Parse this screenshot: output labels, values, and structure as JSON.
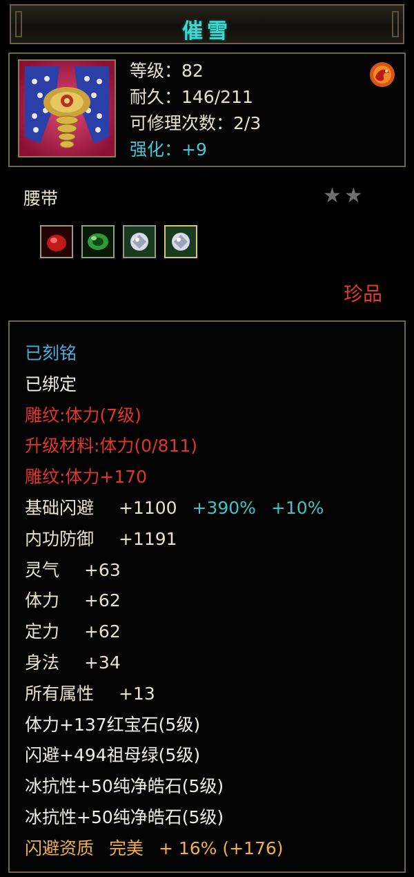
{
  "title": "催雪",
  "item": {
    "stats": {
      "level": "等级：82",
      "durability": "耐久：146/211",
      "repair": "可修理次数：2/3",
      "enhance": "强化：+9"
    },
    "type": "腰带",
    "stars": "★★",
    "quality": "珍品"
  },
  "sockets": [
    {
      "name": "ruby",
      "color": "#c0191c"
    },
    {
      "name": "emerald",
      "color": "#2e9a3a"
    },
    {
      "name": "diamond",
      "color": "#d8dce4"
    },
    {
      "name": "diamond",
      "color": "#d8dce4"
    }
  ],
  "attrs": {
    "inscribed": "已刻铭",
    "bound": "已绑定",
    "engrave1": "雕纹:体力(7级)",
    "upgrade": "升级材料:体力(0/811)",
    "engrave2": "雕纹:体力+170",
    "dodge": {
      "label": "基础闪避",
      "value": "+1100",
      "pct1": "+390%",
      "pct2": "+10%"
    },
    "inner_def": {
      "label": "内功防御",
      "value": "+1191"
    },
    "spirit": {
      "label": "灵气",
      "value": "+63"
    },
    "stamina": {
      "label": "体力",
      "value": "+62"
    },
    "focus": {
      "label": "定力",
      "value": "+62"
    },
    "agility": {
      "label": "身法",
      "value": "+34"
    },
    "all": {
      "label": "所有属性",
      "value": "+13"
    },
    "gem1": "体力+137红宝石(5级)",
    "gem2": "闪避+494祖母绿(5级)",
    "gem3": "冰抗性+50纯净皓石(5级)",
    "gem4": "冰抗性+50纯净皓石(5级)",
    "aptitude": {
      "label": "闪避资质",
      "grade": "完美",
      "value": "+ 16% (+176)"
    }
  }
}
